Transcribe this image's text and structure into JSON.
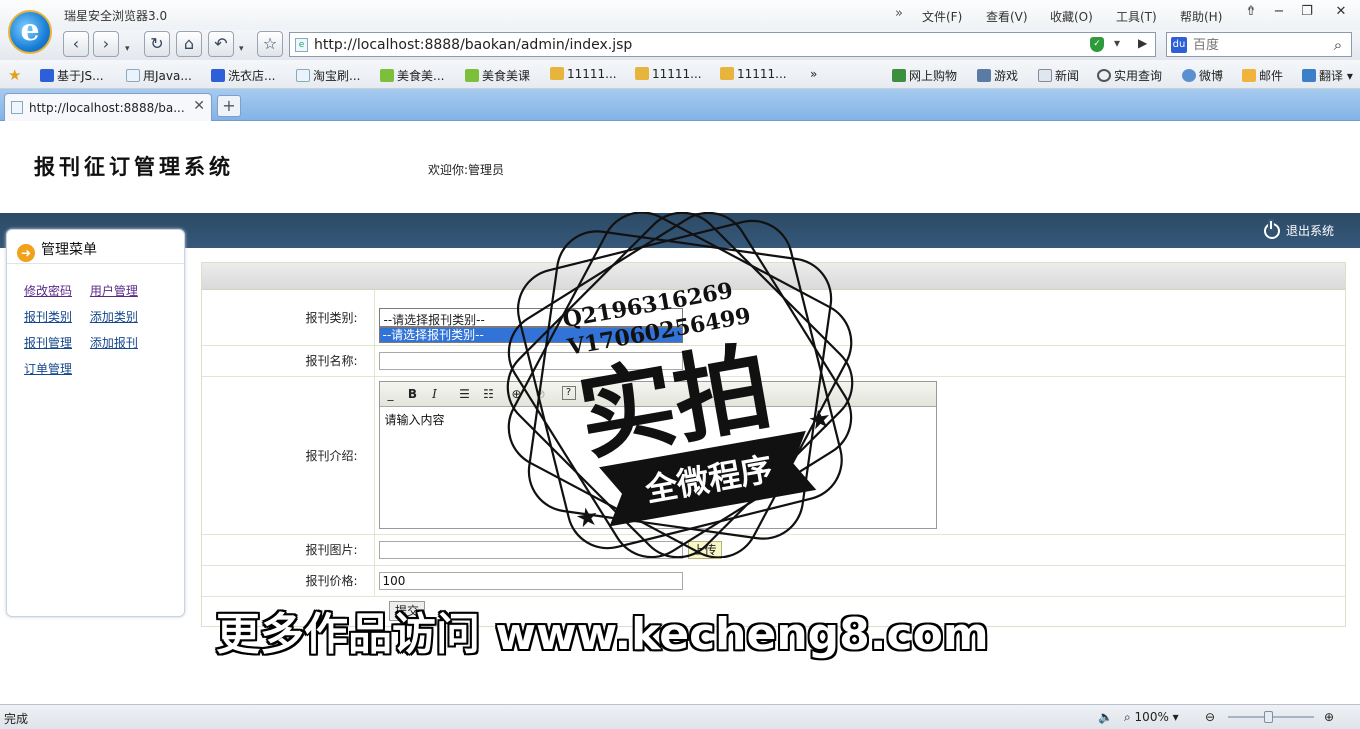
{
  "browser": {
    "window_title": "瑞星安全浏览器3.0",
    "menu": [
      "文件(F)",
      "查看(V)",
      "收藏(O)",
      "工具(T)",
      "帮助(H)"
    ],
    "url": "http://localhost:8888/baokan/admin/index.jsp",
    "search_placeholder": "百度",
    "favorites": [
      "基于JS...",
      "用Java...",
      "洗衣店...",
      "淘宝刷...",
      "美食美...",
      "美食美课",
      "11111...",
      "11111...",
      "11111..."
    ],
    "quick_links": [
      "网上购物",
      "游戏",
      "新闻",
      "实用查询",
      "微博",
      "邮件",
      "翻译"
    ],
    "tab_title": "http://localhost:8888/ba...",
    "new_tab": "+",
    "status": "完成",
    "zoom": "100%"
  },
  "page": {
    "system_title": "报刊征订管理系统",
    "welcome": "欢迎你:管理员",
    "logout": "退出系统",
    "sidebar": {
      "title": "管理菜单",
      "rows": [
        [
          "修改密码",
          "用户管理"
        ],
        [
          "报刊类别",
          "添加类别"
        ],
        [
          "报刊管理",
          "添加报刊"
        ],
        [
          "订单管理"
        ]
      ]
    },
    "form": {
      "category_label": "报刊类别:",
      "category_selected": "--请选择报刊类别--",
      "category_option": "--请选择报刊类别--",
      "name_label": "报刊名称:",
      "name_value": "",
      "intro_label": "报刊介绍:",
      "intro_value": "请输入内容",
      "image_label": "报刊图片:",
      "image_value": "",
      "upload_button": "上传",
      "price_label": "报刊价格:",
      "price_value": "100",
      "submit_button": "提交"
    }
  },
  "watermark": {
    "contact_q": "Q2196316269",
    "contact_v": "V17060256499",
    "stamp_big": "实拍",
    "stamp_ribbon": "全微程序",
    "banner": "更多作品访问 www.kecheng8.com"
  }
}
